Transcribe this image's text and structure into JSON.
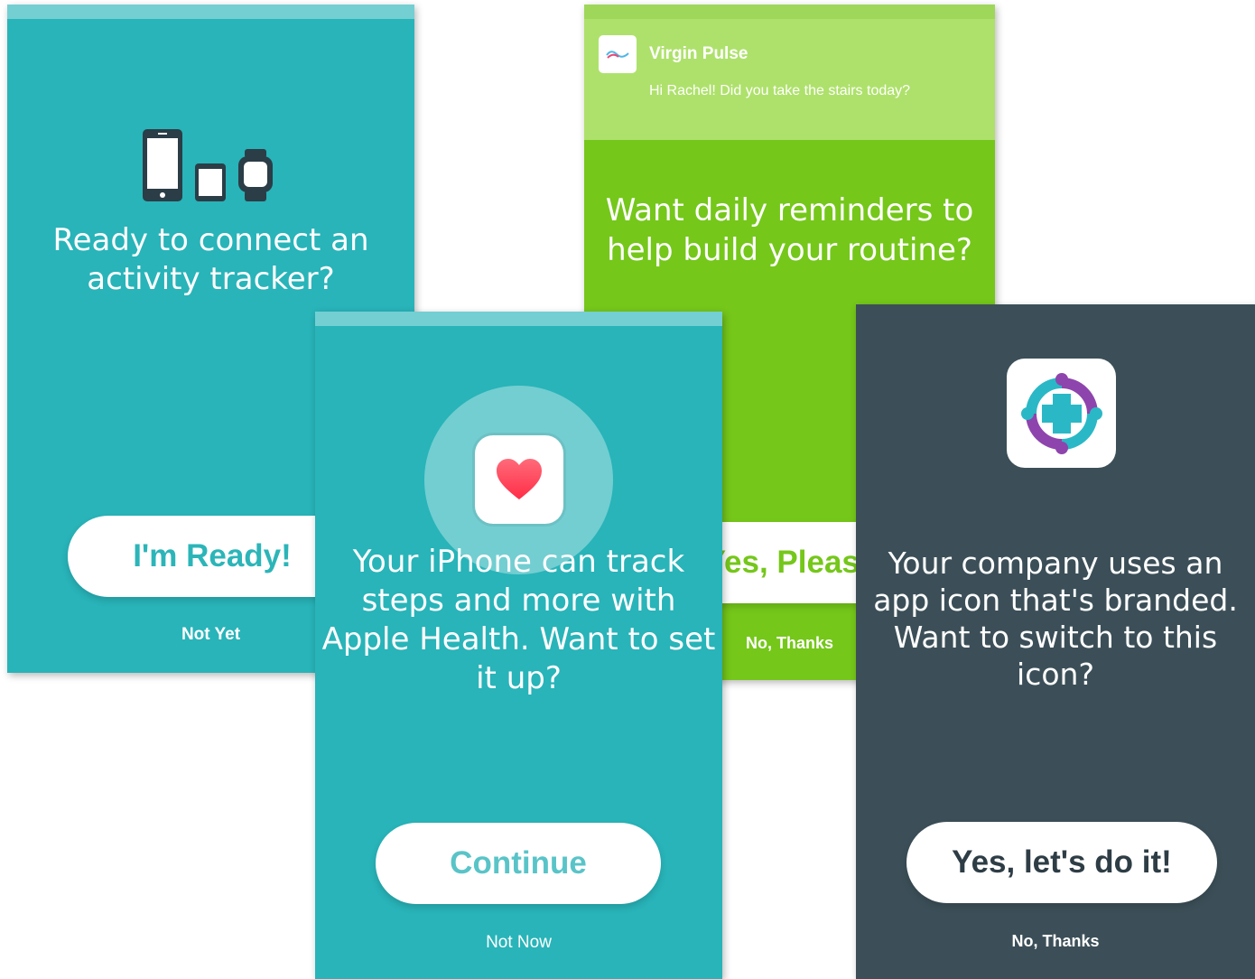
{
  "cards": {
    "tracker": {
      "headline": "Ready to connect an activity tracker?",
      "primary_button": "I'm Ready!",
      "secondary_link": "Not Yet",
      "icon": "devices-icon"
    },
    "reminders": {
      "notification": {
        "app_name": "Virgin Pulse",
        "message": "Hi Rachel! Did you take the stairs today?",
        "icon": "virgin-pulse-logo-icon"
      },
      "headline": "Want daily reminders to help build your routine?",
      "primary_button": "Yes, Please",
      "secondary_link": "No, Thanks"
    },
    "health": {
      "headline": "Your iPhone can track steps and more with Apple Health. Want to set it up?",
      "primary_button": "Continue",
      "secondary_link": "Not Now",
      "icon": "apple-health-heart-icon"
    },
    "brand": {
      "headline": "Your company uses an app icon that's branded. Want to switch to this icon?",
      "primary_button": "Yes, let's do it!",
      "secondary_link": "No, Thanks",
      "icon": "branded-app-icon"
    }
  },
  "colors": {
    "teal": "#28b4b9",
    "green": "#75c71a",
    "slate": "#3c4f58",
    "white": "#ffffff"
  }
}
